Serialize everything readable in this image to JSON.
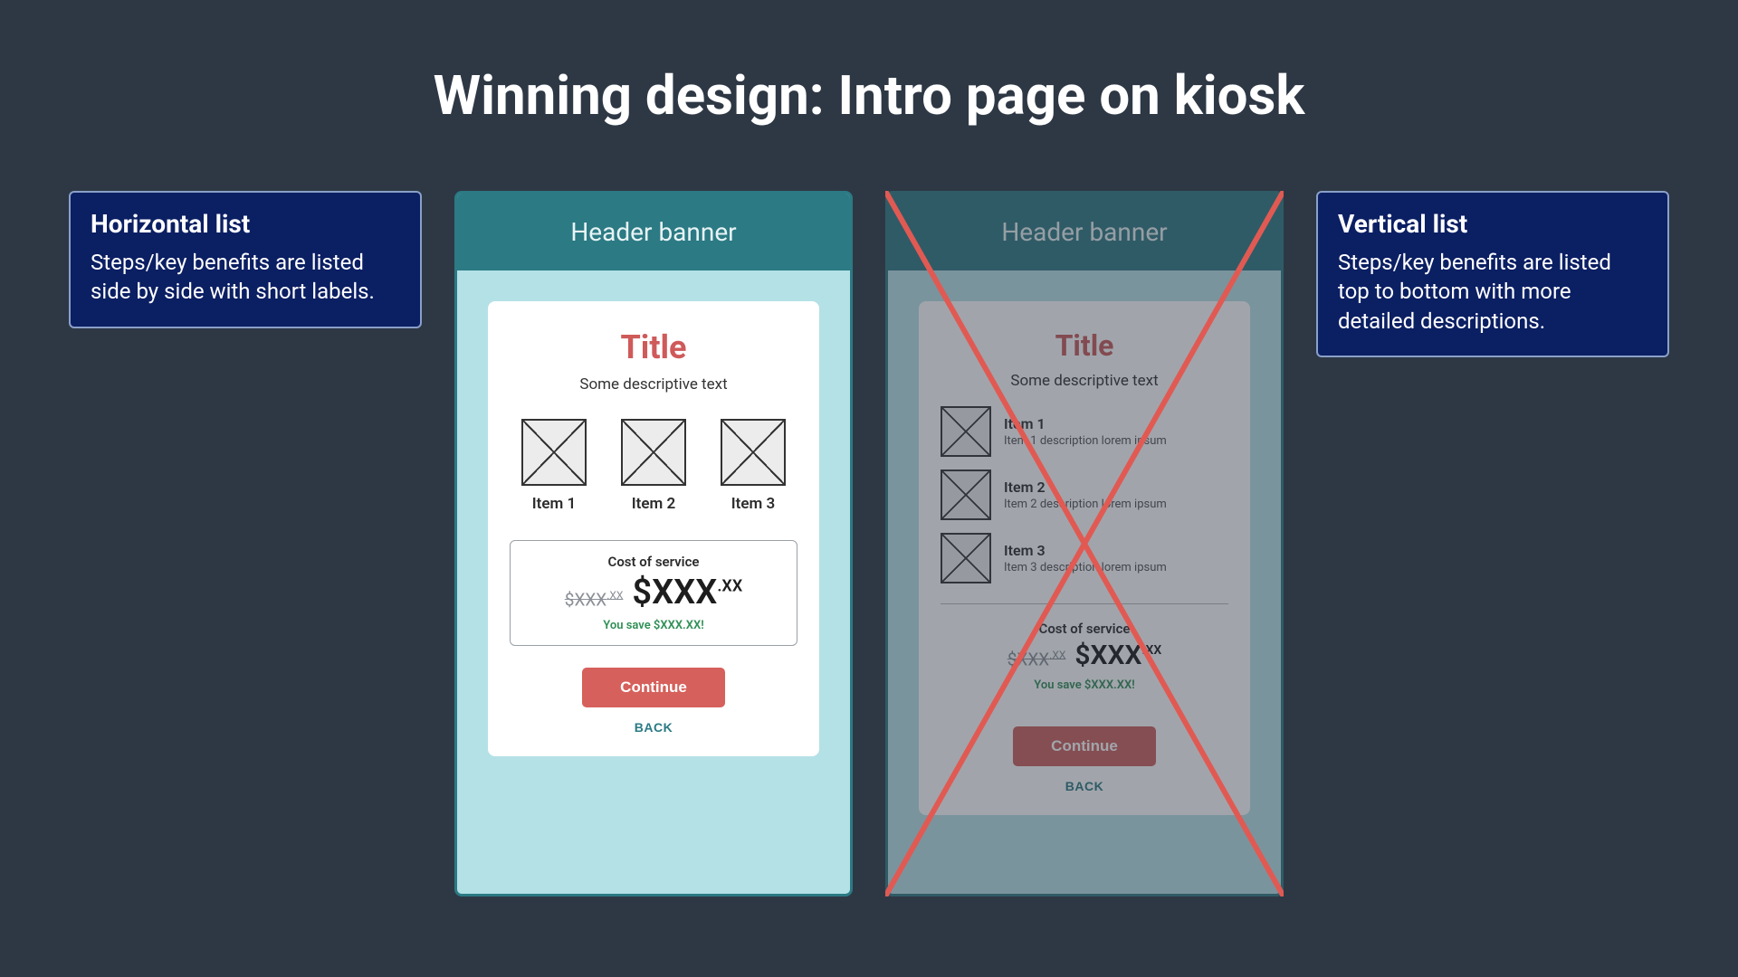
{
  "page": {
    "title": "Winning design: Intro page on kiosk"
  },
  "callouts": {
    "left": {
      "heading": "Horizontal list",
      "body": "Steps/key benefits are listed side by side with short labels."
    },
    "right": {
      "heading": "Vertical list",
      "body": "Steps/key benefits are listed top to bottom with more detailed descriptions."
    }
  },
  "kiosk": {
    "banner": "Header banner",
    "card": {
      "title": "Title",
      "subtitle": "Some descriptive text",
      "cost_label": "Cost of service",
      "old_price_main": "$XXX",
      "old_price_cents": ".XX",
      "new_price_main": "$XXX",
      "new_price_cents": ".XX",
      "save_text": "You save $XXX.XX!",
      "continue": "Continue",
      "back": "BACK"
    }
  },
  "horizontal_items": [
    {
      "label": "Item 1"
    },
    {
      "label": "Item 2"
    },
    {
      "label": "Item 3"
    }
  ],
  "vertical_items": [
    {
      "label": "Item 1",
      "desc": "Item 1 description lorem ipsum"
    },
    {
      "label": "Item 2",
      "desc": "Item 2 description lorem ipsum"
    },
    {
      "label": "Item 3",
      "desc": "Item 3 description lorem ipsum"
    }
  ],
  "colors": {
    "bg": "#2e3845",
    "callout_bg": "#0b1f63",
    "kiosk_bg": "#b4e1e6",
    "kiosk_border": "#2b7a84",
    "title_red": "#cf5a5a",
    "cta_red": "#d6605b",
    "save_green": "#2f8f55",
    "reject_stroke": "#e05a53"
  }
}
